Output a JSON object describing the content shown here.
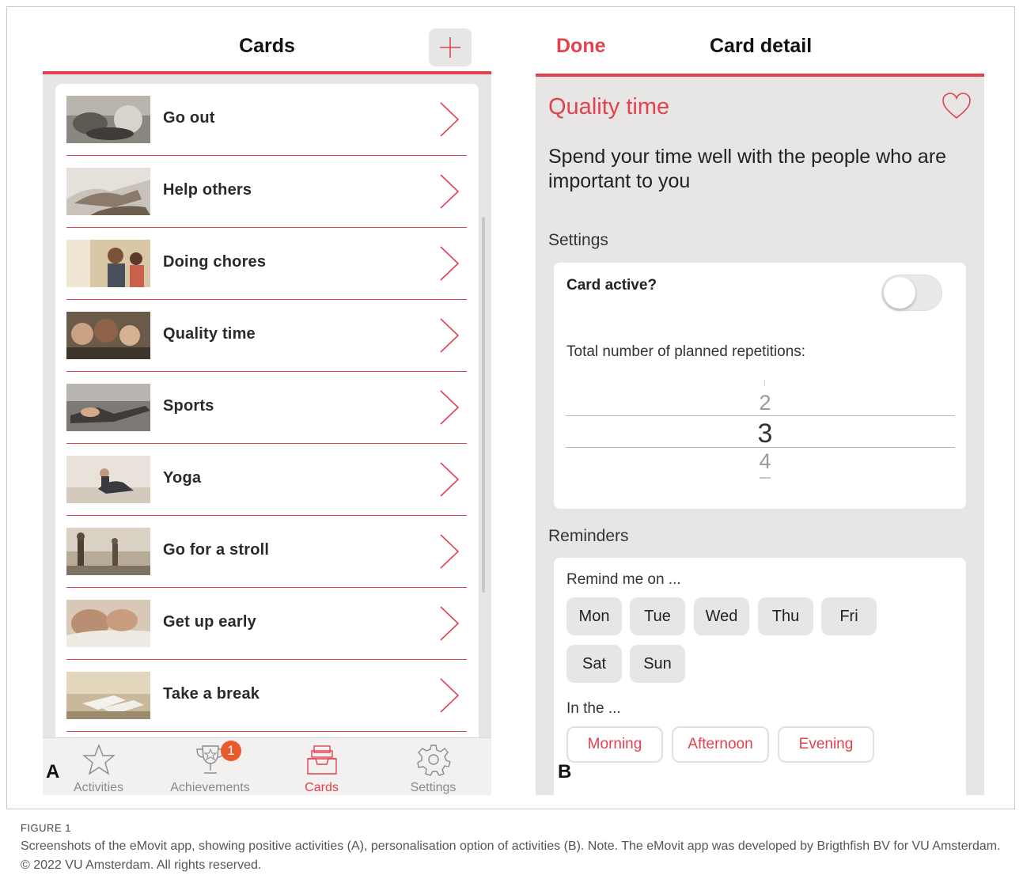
{
  "panel_a": {
    "letter": "A",
    "header_title": "Cards",
    "add_button": "+",
    "cards": [
      {
        "label": "Go out"
      },
      {
        "label": "Help others"
      },
      {
        "label": "Doing chores"
      },
      {
        "label": "Quality time"
      },
      {
        "label": "Sports"
      },
      {
        "label": "Yoga"
      },
      {
        "label": "Go for a stroll"
      },
      {
        "label": "Get up early"
      },
      {
        "label": "Take a break"
      }
    ],
    "tabs": [
      {
        "label": "Activities",
        "icon": "star-icon",
        "active": false
      },
      {
        "label": "Achievements",
        "icon": "trophy-icon",
        "active": false,
        "badge": "1"
      },
      {
        "label": "Cards",
        "icon": "inbox-tray-icon",
        "active": true
      },
      {
        "label": "Settings",
        "icon": "gear-icon",
        "active": false
      }
    ]
  },
  "panel_b": {
    "letter": "B",
    "done_label": "Done",
    "header_title": "Card detail",
    "card_title": "Quality time",
    "description": "Spend your time well with the people who are important to you",
    "settings_heading": "Settings",
    "card_active_label": "Card active?",
    "card_active": false,
    "repetitions_label": "Total number of planned repetitions:",
    "picker": {
      "above": "2",
      "selected": "3",
      "below": "4"
    },
    "reminders_heading": "Reminders",
    "remind_label": "Remind me on ...",
    "days": [
      "Mon",
      "Tue",
      "Wed",
      "Thu",
      "Fri",
      "Sat",
      "Sun"
    ],
    "in_the_label": "In the ...",
    "times": [
      "Morning",
      "Afternoon",
      "Evening"
    ]
  },
  "caption": {
    "label": "FIGURE 1",
    "text": "Screenshots of the eMovit app, showing positive activities (A), personalisation option of activities (B). Note. The eMovit app was developed by Brigthfish BV for VU Amsterdam. © 2022 VU Amsterdam. All rights reserved."
  },
  "colors": {
    "accent": "#e0424f",
    "background": "#e8e6e4",
    "badge": "#e85a2c"
  }
}
